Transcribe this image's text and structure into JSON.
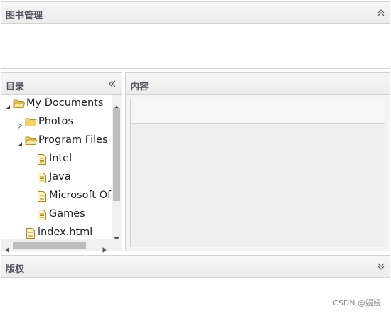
{
  "north": {
    "title": "图书管理",
    "tool": "collapse-up-icon"
  },
  "west": {
    "title": "目录",
    "tool": "collapse-left-icon",
    "tree": [
      {
        "label": "My Documents",
        "level": 0,
        "type": "folder",
        "state": "expanded"
      },
      {
        "label": "Photos",
        "level": 1,
        "type": "folder",
        "state": "collapsed"
      },
      {
        "label": "Program Files",
        "level": 1,
        "type": "folder",
        "state": "expanded"
      },
      {
        "label": "Intel",
        "level": 2,
        "type": "file",
        "state": "leaf"
      },
      {
        "label": "Java",
        "level": 2,
        "type": "file",
        "state": "leaf"
      },
      {
        "label": "Microsoft Of",
        "level": 2,
        "type": "file",
        "state": "leaf"
      },
      {
        "label": "Games",
        "level": 2,
        "type": "file",
        "state": "leaf"
      },
      {
        "label": "index.html",
        "level": 1,
        "type": "file",
        "state": "leaf"
      }
    ]
  },
  "center": {
    "title": "内容"
  },
  "south": {
    "title": "版权",
    "tool": "expand-down-icon"
  },
  "watermark": "CSDN @嫚嫚",
  "colors": {
    "header_bg": "#ececec",
    "border": "#d4d4d4",
    "folder": "#f7d26a",
    "file": "#e8d58a"
  }
}
